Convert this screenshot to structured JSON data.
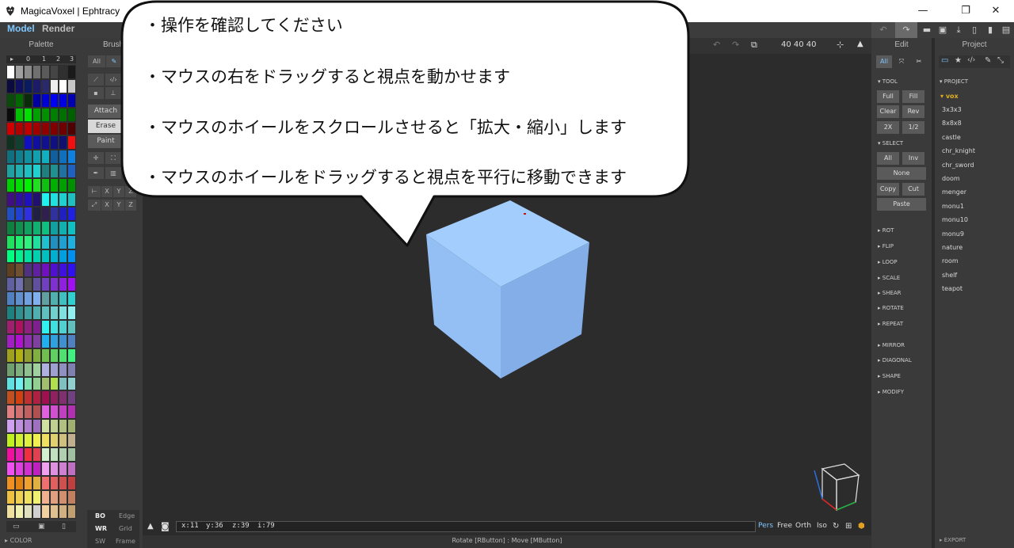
{
  "window": {
    "title": "MagicaVoxel | Ephtracy"
  },
  "menu": {
    "tabs": [
      "Model",
      "Render"
    ],
    "active_tab": "Model"
  },
  "panels": {
    "palette": "Palette",
    "brush": "Brush",
    "edit": "Edit",
    "project": "Project"
  },
  "palette": {
    "page_tabs": [
      "▸",
      "0",
      "1",
      "2",
      "3"
    ],
    "footer_label": "COLOR",
    "selected_index": 301,
    "rows": [
      [
        "#ffffff",
        "#a0a0a0",
        "#8a8a8a",
        "#707070",
        "#5a5a5a",
        "#454545",
        "#303030",
        "#1a1a1a"
      ],
      [
        "#0b0b40",
        "#101060",
        "#0b1b5f",
        "#1b1b6a",
        "#2a2a6a",
        "#eeeeee",
        "#ffffff",
        "#c8c8c8"
      ],
      [
        "#0a4a0a",
        "#006a00",
        "#0a2a0a",
        "#0000a0",
        "#0000d0",
        "#0000f0",
        "#0000e0",
        "#0000b0"
      ],
      [
        "#0a0a0a",
        "#00c000",
        "#00e000",
        "#00a000",
        "#009000",
        "#008000",
        "#007000",
        "#006000"
      ],
      [
        "#d00000",
        "#b00000",
        "#c00000",
        "#a00000",
        "#900000",
        "#800000",
        "#700000",
        "#500000"
      ],
      [
        "#103020",
        "#104030",
        "#1010c0",
        "#1010a0",
        "#101090",
        "#101080",
        "#101070",
        "#f01010"
      ],
      [
        "#107080",
        "#108090",
        "#1090a0",
        "#10a0b0",
        "#10b0c0",
        "#1060a0",
        "#1070c0",
        "#1080e0"
      ],
      [
        "#20a0a0",
        "#20b0b0",
        "#20c0c0",
        "#20d0d0",
        "#208080",
        "#209090",
        "#2070a0",
        "#2060c0"
      ],
      [
        "#00d000",
        "#00e000",
        "#00f000",
        "#20e020",
        "#10c010",
        "#00b000",
        "#00a000",
        "#009000"
      ],
      [
        "#401080",
        "#3010a0",
        "#2010c0",
        "#201070",
        "#20f0f0",
        "#20e0e0",
        "#20d0d0",
        "#20c0c0"
      ],
      [
        "#2050c0",
        "#2040d0",
        "#3030e0",
        "#202040",
        "#302050",
        "#3030a0",
        "#2020c0",
        "#2020e0"
      ],
      [
        "#108040",
        "#109050",
        "#10a060",
        "#10b070",
        "#10c080",
        "#10a0a0",
        "#10b0b0",
        "#10c0c0"
      ],
      [
        "#20e060",
        "#20f070",
        "#30f080",
        "#20e0a0",
        "#20c0d0",
        "#2090c0",
        "#20a0d0",
        "#20b0e0"
      ],
      [
        "#00ff80",
        "#00f090",
        "#00e0a0",
        "#00d0b0",
        "#00c0c0",
        "#00b0d0",
        "#00a0e0",
        "#0090f0"
      ],
      [
        "#604020",
        "#705030",
        "#503080",
        "#6020a0",
        "#7010c0",
        "#5010d0",
        "#4010e0",
        "#3010f0"
      ],
      [
        "#6060a0",
        "#7070b0",
        "#505050",
        "#6050a0",
        "#7040c0",
        "#8030d0",
        "#9020e0",
        "#a010f0"
      ],
      [
        "#5080c0",
        "#6090d0",
        "#70a0e0",
        "#80b0f0",
        "#60a0a0",
        "#50b0b0",
        "#40c0c0",
        "#30d0d0"
      ],
      [
        "#208080",
        "#309090",
        "#40a0a0",
        "#50b0b0",
        "#60c0c0",
        "#70d0d0",
        "#80e0e0",
        "#90f0f0"
      ],
      [
        "#a02070",
        "#b01060",
        "#902080",
        "#802090",
        "#30f0f0",
        "#40e0e0",
        "#50d0d0",
        "#60c0c0"
      ],
      [
        "#a020c0",
        "#b010d0",
        "#9030b0",
        "#8040a0",
        "#20b0f0",
        "#30a0e0",
        "#4090d0",
        "#5080c0"
      ],
      [
        "#a0a020",
        "#b0b010",
        "#90a030",
        "#80b040",
        "#70c050",
        "#60d060",
        "#50e070",
        "#40f080"
      ],
      [
        "#70a070",
        "#80b080",
        "#90c090",
        "#a0d0a0",
        "#b0b0e0",
        "#a0a0d0",
        "#9090c0",
        "#8080b0"
      ],
      [
        "#60e0e0",
        "#70f0f0",
        "#80e0b0",
        "#90d090",
        "#a0c070",
        "#b0e050",
        "#80c0c0",
        "#90d0d0"
      ],
      [
        "#c05020",
        "#d04010",
        "#c03030",
        "#b02040",
        "#a01050",
        "#902060",
        "#803070",
        "#704080"
      ],
      [
        "#e08080",
        "#d07070",
        "#c06060",
        "#b05050",
        "#e060e0",
        "#d050d0",
        "#c040c0",
        "#b030b0"
      ],
      [
        "#d0a0f0",
        "#c090e0",
        "#b080d0",
        "#a070c0",
        "#d0e0a0",
        "#c0d090",
        "#b0c080",
        "#a0b070"
      ],
      [
        "#c0f020",
        "#d0f030",
        "#e0f040",
        "#f0f050",
        "#f0e060",
        "#e0d070",
        "#d0c080",
        "#c0b090"
      ],
      [
        "#f010a0",
        "#e020b0",
        "#f03040",
        "#e04050",
        "#d0f0d0",
        "#c0e0c0",
        "#b0d0b0",
        "#a0c0a0"
      ],
      [
        "#f050f0",
        "#e040e0",
        "#d030d0",
        "#c020c0",
        "#f0a0f0",
        "#e090e0",
        "#d080d0",
        "#c070c0"
      ],
      [
        "#f09020",
        "#e08010",
        "#f0a030",
        "#e0b040",
        "#f07070",
        "#e06060",
        "#d05050",
        "#c04040"
      ],
      [
        "#f0c040",
        "#f0d050",
        "#f0e060",
        "#f0f070",
        "#f0b090",
        "#e0a080",
        "#d09070",
        "#c08060"
      ],
      [
        "#f0e0a0",
        "#f0f0b0",
        "#e0e0c0",
        "#d0d0d0",
        "#f0d0a0",
        "#e0c090",
        "#d0b080",
        "#c0a070"
      ]
    ],
    "footer_icons": [
      "folder-icon",
      "save-icon",
      "file-icon"
    ]
  },
  "brush": {
    "mode_all": "All",
    "actions": [
      "Attach",
      "Erase",
      "Paint"
    ],
    "axes_row1": [
      "X",
      "Y",
      "Z"
    ],
    "axes_row2": [
      "X",
      "Y",
      "Z"
    ]
  },
  "bubble": {
    "lines": [
      "・操作を確認してください",
      "・マウスの右をドラッグすると視点を動かせます",
      "・マウスのホイールをスクロールさせると「拡大・縮小」します",
      "・マウスのホイールをドラッグすると視点を平行に移動できます"
    ]
  },
  "viewport": {
    "dims": "40  40  40",
    "cube_color": "#8fb8ee",
    "status": {
      "x": "x:11",
      "y": "y:36",
      "z": "z:39",
      "i": "i:79"
    },
    "view_modes": [
      "Pers",
      "Free",
      "Orth",
      "Iso"
    ],
    "active_view_mode": "Pers",
    "hint": "Rotate [RButton] : Move [MButton]",
    "bottom_left_toggles": [
      {
        "on": "BO",
        "off": "Edge"
      },
      {
        "on": "WR",
        "off": "Grid"
      },
      {
        "on": "SW",
        "off": "Frame"
      }
    ]
  },
  "edit": {
    "tabs": [
      "All",
      "expand-icon",
      "wrench-icon"
    ],
    "tool_label": "TOOL",
    "tool_buttons": [
      [
        "Full",
        "Fill"
      ],
      [
        "Clear",
        "Rev"
      ],
      [
        "2X",
        "1/2"
      ]
    ],
    "select_label": "SELECT",
    "select_buttons": [
      [
        "All",
        "Inv"
      ]
    ],
    "none": "None",
    "copy_cut": [
      "Copy",
      "Cut"
    ],
    "paste": "Paste",
    "sections": [
      "ROT",
      "FLIP",
      "LOOP",
      "SCALE",
      "SHEAR",
      "ROTATE",
      "REPEAT",
      "MIRROR",
      "DIAGONAL",
      "SHAPE",
      "MODIFY"
    ]
  },
  "project": {
    "header": "PROJECT",
    "folder": "vox",
    "items": [
      "3x3x3",
      "8x8x8",
      "castle",
      "chr_knight",
      "chr_sword",
      "doom",
      "menger",
      "monu1",
      "monu10",
      "monu9",
      "nature",
      "room",
      "shelf",
      "teapot"
    ],
    "export": "EXPORT"
  },
  "colors": {
    "accent": "#7fc7ff",
    "folder": "#e0b020",
    "bubble_stroke": "#111111"
  }
}
